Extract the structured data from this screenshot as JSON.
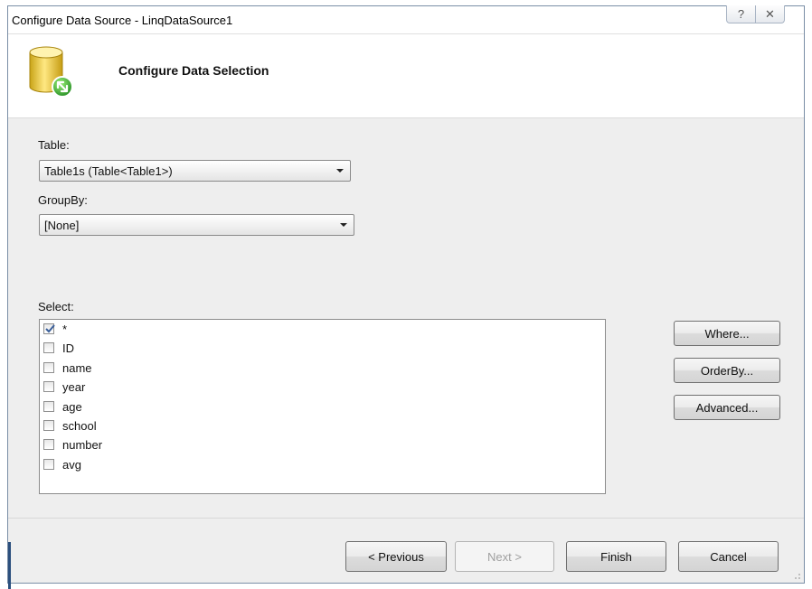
{
  "window": {
    "title": "Configure Data Source - LinqDataSource1",
    "help_glyph": "?",
    "close_glyph": "✕"
  },
  "header": {
    "title": "Configure Data Selection",
    "icon": "database-icon"
  },
  "table": {
    "label": "Table:",
    "selected": "Table1s (Table<Table1>)"
  },
  "groupby": {
    "label": "GroupBy:",
    "selected": "[None]"
  },
  "select": {
    "label": "Select:",
    "items": [
      {
        "label": "*",
        "checked": true
      },
      {
        "label": "ID",
        "checked": false
      },
      {
        "label": "name",
        "checked": false
      },
      {
        "label": "year",
        "checked": false
      },
      {
        "label": "age",
        "checked": false
      },
      {
        "label": "school",
        "checked": false
      },
      {
        "label": "number",
        "checked": false
      },
      {
        "label": "avg",
        "checked": false
      }
    ]
  },
  "side_buttons": {
    "where": "Where...",
    "orderby": "OrderBy...",
    "advanced": "Advanced..."
  },
  "footer": {
    "previous": "< Previous",
    "next": "Next >",
    "finish": "Finish",
    "cancel": "Cancel"
  },
  "colors": {
    "window_border": "#7a8ea6",
    "dialog_bg": "#eeeeee",
    "check_color": "#3a5f9a"
  }
}
